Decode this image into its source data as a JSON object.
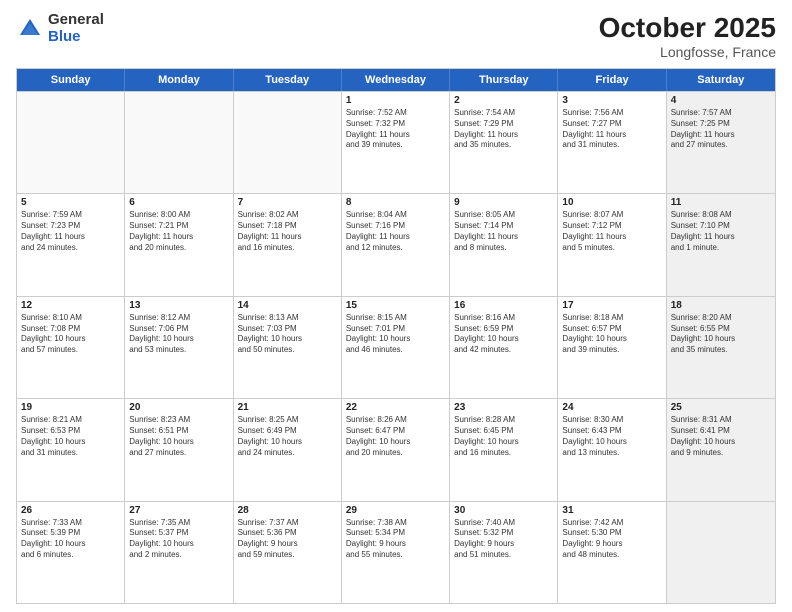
{
  "logo": {
    "general": "General",
    "blue": "Blue"
  },
  "title": {
    "month": "October 2025",
    "location": "Longfosse, France"
  },
  "header": {
    "days": [
      "Sunday",
      "Monday",
      "Tuesday",
      "Wednesday",
      "Thursday",
      "Friday",
      "Saturday"
    ]
  },
  "weeks": [
    [
      {
        "day": "",
        "text": "",
        "empty": true
      },
      {
        "day": "",
        "text": "",
        "empty": true
      },
      {
        "day": "",
        "text": "",
        "empty": true
      },
      {
        "day": "1",
        "text": "Sunrise: 7:52 AM\nSunset: 7:32 PM\nDaylight: 11 hours\nand 39 minutes.",
        "empty": false
      },
      {
        "day": "2",
        "text": "Sunrise: 7:54 AM\nSunset: 7:29 PM\nDaylight: 11 hours\nand 35 minutes.",
        "empty": false
      },
      {
        "day": "3",
        "text": "Sunrise: 7:56 AM\nSunset: 7:27 PM\nDaylight: 11 hours\nand 31 minutes.",
        "empty": false
      },
      {
        "day": "4",
        "text": "Sunrise: 7:57 AM\nSunset: 7:25 PM\nDaylight: 11 hours\nand 27 minutes.",
        "empty": false,
        "shaded": true
      }
    ],
    [
      {
        "day": "5",
        "text": "Sunrise: 7:59 AM\nSunset: 7:23 PM\nDaylight: 11 hours\nand 24 minutes.",
        "empty": false
      },
      {
        "day": "6",
        "text": "Sunrise: 8:00 AM\nSunset: 7:21 PM\nDaylight: 11 hours\nand 20 minutes.",
        "empty": false
      },
      {
        "day": "7",
        "text": "Sunrise: 8:02 AM\nSunset: 7:18 PM\nDaylight: 11 hours\nand 16 minutes.",
        "empty": false
      },
      {
        "day": "8",
        "text": "Sunrise: 8:04 AM\nSunset: 7:16 PM\nDaylight: 11 hours\nand 12 minutes.",
        "empty": false
      },
      {
        "day": "9",
        "text": "Sunrise: 8:05 AM\nSunset: 7:14 PM\nDaylight: 11 hours\nand 8 minutes.",
        "empty": false
      },
      {
        "day": "10",
        "text": "Sunrise: 8:07 AM\nSunset: 7:12 PM\nDaylight: 11 hours\nand 5 minutes.",
        "empty": false
      },
      {
        "day": "11",
        "text": "Sunrise: 8:08 AM\nSunset: 7:10 PM\nDaylight: 11 hours\nand 1 minute.",
        "empty": false,
        "shaded": true
      }
    ],
    [
      {
        "day": "12",
        "text": "Sunrise: 8:10 AM\nSunset: 7:08 PM\nDaylight: 10 hours\nand 57 minutes.",
        "empty": false
      },
      {
        "day": "13",
        "text": "Sunrise: 8:12 AM\nSunset: 7:06 PM\nDaylight: 10 hours\nand 53 minutes.",
        "empty": false
      },
      {
        "day": "14",
        "text": "Sunrise: 8:13 AM\nSunset: 7:03 PM\nDaylight: 10 hours\nand 50 minutes.",
        "empty": false
      },
      {
        "day": "15",
        "text": "Sunrise: 8:15 AM\nSunset: 7:01 PM\nDaylight: 10 hours\nand 46 minutes.",
        "empty": false
      },
      {
        "day": "16",
        "text": "Sunrise: 8:16 AM\nSunset: 6:59 PM\nDaylight: 10 hours\nand 42 minutes.",
        "empty": false
      },
      {
        "day": "17",
        "text": "Sunrise: 8:18 AM\nSunset: 6:57 PM\nDaylight: 10 hours\nand 39 minutes.",
        "empty": false
      },
      {
        "day": "18",
        "text": "Sunrise: 8:20 AM\nSunset: 6:55 PM\nDaylight: 10 hours\nand 35 minutes.",
        "empty": false,
        "shaded": true
      }
    ],
    [
      {
        "day": "19",
        "text": "Sunrise: 8:21 AM\nSunset: 6:53 PM\nDaylight: 10 hours\nand 31 minutes.",
        "empty": false
      },
      {
        "day": "20",
        "text": "Sunrise: 8:23 AM\nSunset: 6:51 PM\nDaylight: 10 hours\nand 27 minutes.",
        "empty": false
      },
      {
        "day": "21",
        "text": "Sunrise: 8:25 AM\nSunset: 6:49 PM\nDaylight: 10 hours\nand 24 minutes.",
        "empty": false
      },
      {
        "day": "22",
        "text": "Sunrise: 8:26 AM\nSunset: 6:47 PM\nDaylight: 10 hours\nand 20 minutes.",
        "empty": false
      },
      {
        "day": "23",
        "text": "Sunrise: 8:28 AM\nSunset: 6:45 PM\nDaylight: 10 hours\nand 16 minutes.",
        "empty": false
      },
      {
        "day": "24",
        "text": "Sunrise: 8:30 AM\nSunset: 6:43 PM\nDaylight: 10 hours\nand 13 minutes.",
        "empty": false
      },
      {
        "day": "25",
        "text": "Sunrise: 8:31 AM\nSunset: 6:41 PM\nDaylight: 10 hours\nand 9 minutes.",
        "empty": false,
        "shaded": true
      }
    ],
    [
      {
        "day": "26",
        "text": "Sunrise: 7:33 AM\nSunset: 5:39 PM\nDaylight: 10 hours\nand 6 minutes.",
        "empty": false
      },
      {
        "day": "27",
        "text": "Sunrise: 7:35 AM\nSunset: 5:37 PM\nDaylight: 10 hours\nand 2 minutes.",
        "empty": false
      },
      {
        "day": "28",
        "text": "Sunrise: 7:37 AM\nSunset: 5:36 PM\nDaylight: 9 hours\nand 59 minutes.",
        "empty": false
      },
      {
        "day": "29",
        "text": "Sunrise: 7:38 AM\nSunset: 5:34 PM\nDaylight: 9 hours\nand 55 minutes.",
        "empty": false
      },
      {
        "day": "30",
        "text": "Sunrise: 7:40 AM\nSunset: 5:32 PM\nDaylight: 9 hours\nand 51 minutes.",
        "empty": false
      },
      {
        "day": "31",
        "text": "Sunrise: 7:42 AM\nSunset: 5:30 PM\nDaylight: 9 hours\nand 48 minutes.",
        "empty": false
      },
      {
        "day": "",
        "text": "",
        "empty": true,
        "shaded": true
      }
    ]
  ]
}
